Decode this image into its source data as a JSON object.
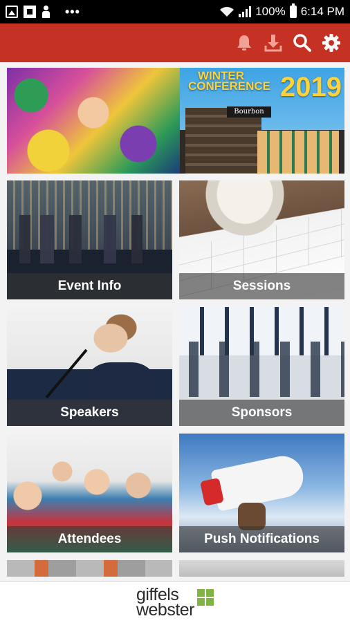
{
  "status_bar": {
    "left_icons": [
      "picture-icon",
      "flipboard-icon",
      "person-icon"
    ],
    "overflow": "•••",
    "battery": "100%",
    "time": "6:14 PM"
  },
  "app_bar": {
    "actions": [
      "bell-icon",
      "download-icon",
      "search-icon",
      "gear-icon"
    ],
    "color": "#c53224"
  },
  "banner": {
    "title_line1": "WINTER",
    "title_line2": "CONFERENCE",
    "year": "2019",
    "street_sign": "Bourbon"
  },
  "tiles": [
    {
      "label": "Event Info"
    },
    {
      "label": "Sessions"
    },
    {
      "label": "Speakers"
    },
    {
      "label": "Sponsors"
    },
    {
      "label": "Attendees"
    },
    {
      "label": "Push Notifications"
    }
  ],
  "footer": {
    "logo_line1": "giffels",
    "logo_line2": "webster",
    "logo_color": "#7fb442"
  }
}
